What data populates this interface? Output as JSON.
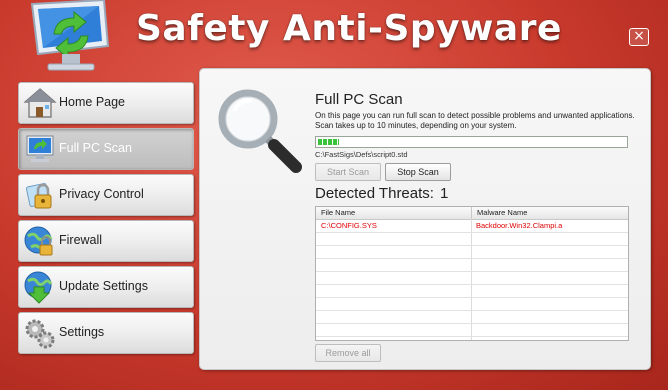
{
  "app": {
    "title": "Safety Anti-Spyware",
    "close_label": "×"
  },
  "nav": {
    "items": [
      {
        "label": "Home Page",
        "icon": "house-icon"
      },
      {
        "label": "Full PC Scan",
        "icon": "monitor-scan-icon",
        "active": true
      },
      {
        "label": "Privacy Control",
        "icon": "lock-icon"
      },
      {
        "label": "Firewall",
        "icon": "globe-lock-icon"
      },
      {
        "label": "Update Settings",
        "icon": "globe-download-icon"
      },
      {
        "label": "Settings",
        "icon": "gears-icon"
      }
    ]
  },
  "scan": {
    "title": "Full PC Scan",
    "description": "On this page you can run full scan to detect possible problems and unwanted applications. Scan takes up to 10 minutes, depending on your system.",
    "progress": 0.07,
    "current_file": "C:\\FastSigs\\Defs\\script0.std",
    "start_label": "Start Scan",
    "stop_label": "Stop Scan"
  },
  "threats": {
    "title": "Detected Threats:",
    "count": "1",
    "columns": [
      "File Name",
      "Malware Name"
    ],
    "rows": [
      {
        "file": "C:\\CONFIG.SYS",
        "malware": "Backdoor.Win32.Clampi.a"
      }
    ],
    "remove_label": "Remove all"
  },
  "colors": {
    "background": "#c8392c",
    "threat_text": "#e00000",
    "progress": "#39c33a"
  }
}
